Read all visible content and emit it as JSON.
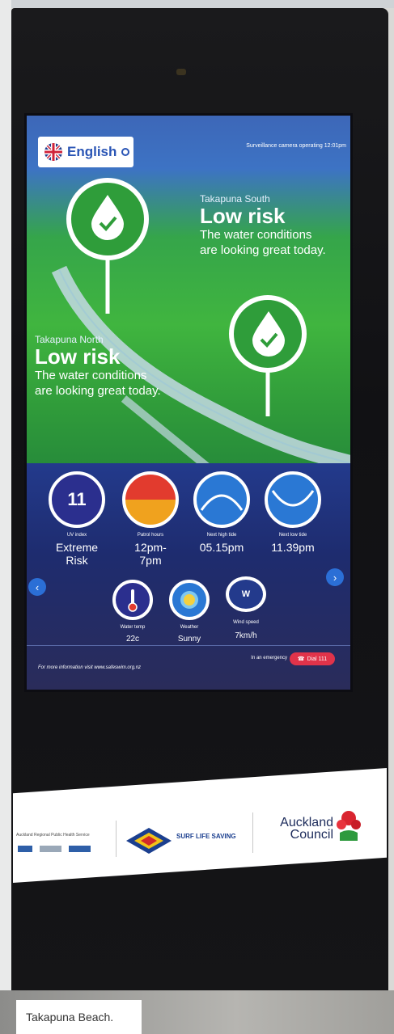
{
  "screen": {
    "language_label": "English",
    "status_text": "Surveillance camera operating  12:01pm",
    "south": {
      "location": "Takapuna South",
      "risk": "Low risk",
      "description_line1": "The water conditions",
      "description_line2": "are looking great today."
    },
    "north": {
      "location": "Takapuna North",
      "risk": "Low risk",
      "description_line1": "The water conditions",
      "description_line2": "are looking great today."
    },
    "stats": {
      "uv": {
        "value": "11",
        "label": "UV index",
        "text_line1": "Extreme",
        "text_line2": "Risk"
      },
      "patrol": {
        "label": "Patrol hours",
        "text_line1": "12pm-",
        "text_line2": "7pm"
      },
      "high_tide": {
        "label": "Next high tide",
        "text": "05.15pm"
      },
      "low_tide": {
        "label": "Next low tide",
        "text": "11.39pm"
      },
      "water_temp": {
        "label": "Water temp",
        "text": "22c"
      },
      "weather": {
        "label": "Weather",
        "text": "Sunny"
      },
      "wind": {
        "label": "Wind speed",
        "text": "7km/h",
        "direction": "W"
      }
    },
    "footer_info": "For more information visit www.safeswim.org.nz",
    "emergency_text": "In an emergency",
    "sos_label": "Dial 111"
  },
  "sponsors": {
    "partner1": "Auckland Regional Public Health Service",
    "partner2": "SURF LIFE SAVING",
    "council_line1": "Auckland",
    "council_line2": "Council"
  },
  "caption": "Takapuna Beach.",
  "colors": {
    "screen_blue": "#233a8c",
    "grass_green": "#40b53f",
    "accent_blue": "#2b6fd6",
    "sos_red": "#e0334a"
  }
}
